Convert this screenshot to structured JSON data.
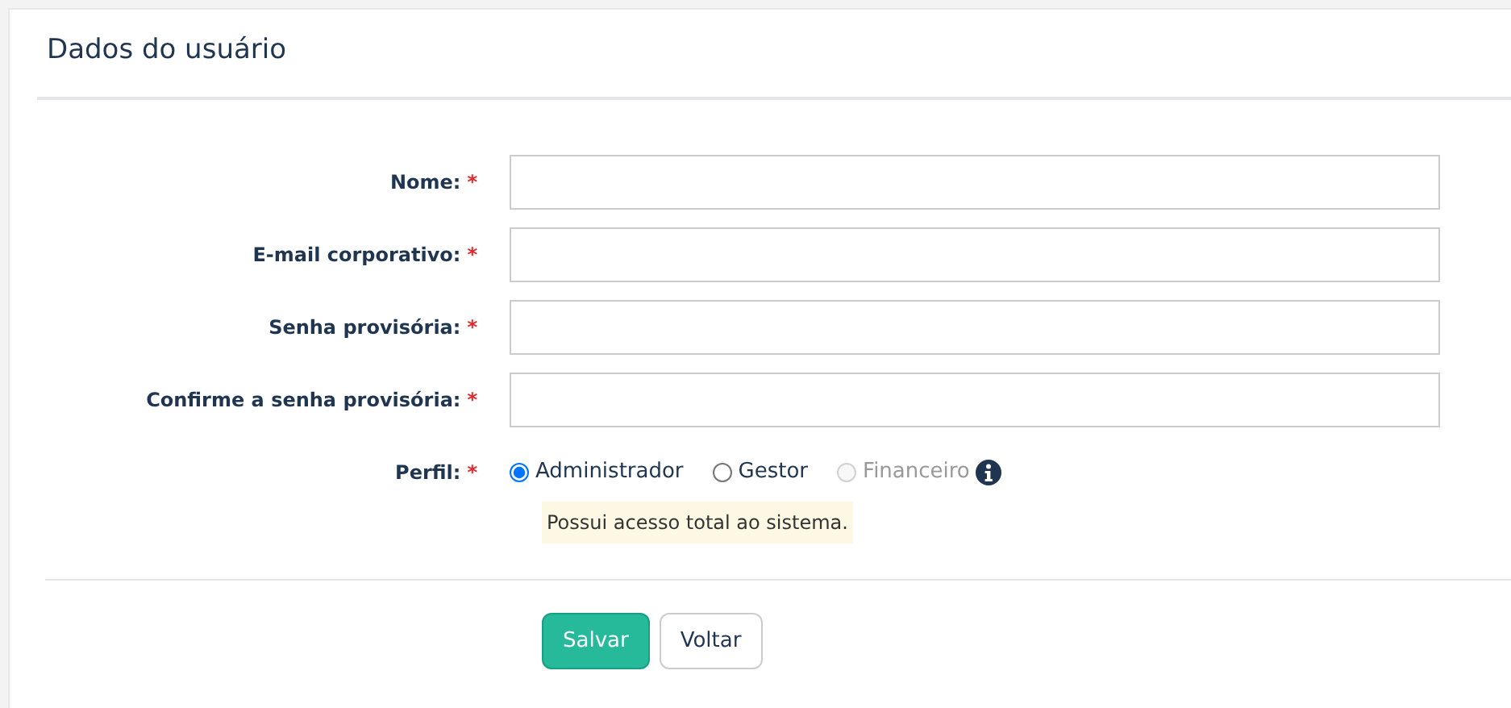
{
  "title": "Dados do usuário",
  "fields": [
    {
      "label": "Nome:",
      "required": true
    },
    {
      "label": "E-mail corporativo:",
      "required": true
    },
    {
      "label": "Senha provisória:",
      "required": true
    },
    {
      "label": "Confirme a senha provisória:",
      "required": true
    }
  ],
  "profile": {
    "label": "Perfil:",
    "required": true,
    "options": [
      {
        "label": "Administrador",
        "selected": true,
        "disabled": false
      },
      {
        "label": "Gestor",
        "selected": false,
        "disabled": false
      },
      {
        "label": "Financeiro",
        "selected": false,
        "disabled": true
      }
    ],
    "hint": "Possui acesso total ao sistema."
  },
  "required_mark": "*",
  "buttons": [
    {
      "label": "Salvar",
      "kind": "primary"
    },
    {
      "label": "Voltar",
      "kind": "secondary"
    }
  ]
}
